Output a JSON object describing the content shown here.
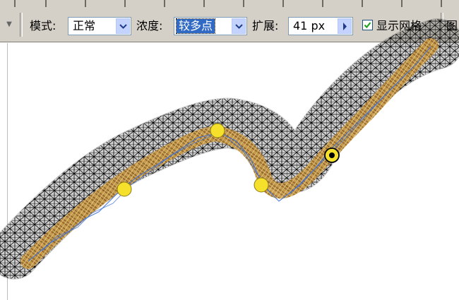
{
  "toolbar": {
    "mode_label": "模式:",
    "mode_value": "正常",
    "density_label": "浓度:",
    "density_value": "较多点",
    "expand_label": "扩展:",
    "expand_value": "41 px",
    "show_mesh_label": "显示网格",
    "show_mesh_checked": true,
    "trailing_label": "图"
  },
  "canvas": {
    "pins": [
      {
        "kind": "pin",
        "color": "#f5e12c"
      },
      {
        "kind": "pin",
        "color": "#f5e12c"
      },
      {
        "kind": "pin",
        "color": "#f5e12c"
      },
      {
        "kind": "selected-pin",
        "color": "#f5e12c"
      }
    ],
    "mesh_color": "#000000",
    "ribbon_color": "#c99a45",
    "edge_color": "#3b6fd6"
  }
}
